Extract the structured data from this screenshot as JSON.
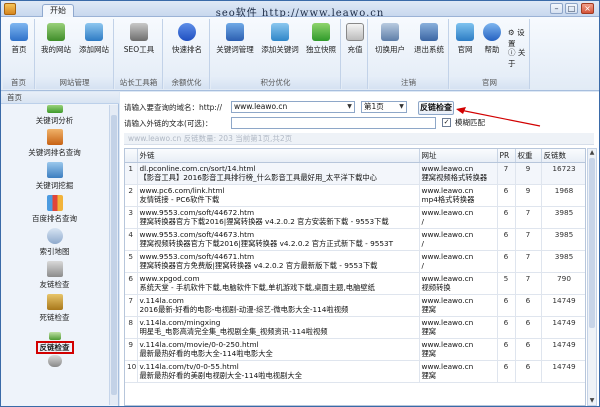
{
  "window": {
    "title": "seo软件   http://www.leawo.cn",
    "tab": "开始",
    "min": "–",
    "max": "□",
    "close": "×"
  },
  "ribbon": {
    "groups": [
      {
        "label": "首页",
        "buttons": [
          {
            "label": "首页",
            "icon": "home-icon"
          }
        ]
      },
      {
        "label": "网站管理",
        "buttons": [
          {
            "label": "我的网站",
            "icon": "my-site-icon"
          },
          {
            "label": "添加网站",
            "icon": "add-site-icon"
          }
        ]
      },
      {
        "label": "站长工具箱",
        "buttons": [
          {
            "label": "SEO工具",
            "icon": "tools-icon"
          }
        ]
      },
      {
        "label": "余额优化",
        "buttons": [
          {
            "label": "快速排名",
            "icon": "baidu-paw-icon"
          }
        ]
      },
      {
        "label": "积分优化",
        "buttons": [
          {
            "label": "关键词管理",
            "icon": "keyword-manage-icon"
          },
          {
            "label": "添加关键词",
            "icon": "add-keyword-icon"
          },
          {
            "label": "独立快照",
            "icon": "snapshot-icon"
          }
        ]
      },
      {
        "label": "",
        "buttons": [
          {
            "label": "充值",
            "icon": "recharge-icon"
          }
        ]
      },
      {
        "label": "注销",
        "buttons": [
          {
            "label": "切换用户",
            "icon": "switch-user-icon"
          },
          {
            "label": "退出系统",
            "icon": "exit-icon"
          }
        ]
      },
      {
        "label": "官网",
        "buttons": [
          {
            "label": "官网",
            "icon": "website-icon"
          },
          {
            "label": "帮助",
            "icon": "help-icon"
          }
        ]
      }
    ],
    "settings": "设置",
    "about": "关于"
  },
  "nav": {
    "header": "首页",
    "items": [
      {
        "label": "关键词分析",
        "icon": "keyword-analysis-icon"
      },
      {
        "label": "关键词排名查询",
        "icon": "rank-query-icon"
      },
      {
        "label": "关键词挖掘",
        "icon": "keyword-mining-icon"
      },
      {
        "label": "百度排名查询",
        "icon": "baidu-rank-icon"
      },
      {
        "label": "索引地图",
        "icon": "sitemap-icon"
      },
      {
        "label": "友链检查",
        "icon": "friend-link-icon"
      },
      {
        "label": "死链检查",
        "icon": "dead-link-icon"
      },
      {
        "label": "反链检查",
        "icon": "backlink-icon"
      }
    ]
  },
  "query": {
    "domain_label": "请输入要查询的域名：http://",
    "domain_value": "www.leawo.cn",
    "page_value": "第1页",
    "check_button": "反链检查",
    "text_label": "请输入外链的文本(可选)：",
    "text_value": "",
    "fuzzy_label": "模糊匹配",
    "fuzzy_checked": "✓",
    "status": "www.leawo.cn  反链数量: 203  当前第1页,共2页"
  },
  "table": {
    "columns": [
      "",
      "外链",
      "网址",
      "PR",
      "权重",
      "反链数"
    ],
    "rows": [
      {
        "n": "1",
        "url": "dl.pconline.com.cn/sort/14.html",
        "title": "【影音工具】2016影音工具排行榜_什么影音工具最好用_太平洋下载中心",
        "site": "www.leawo.cn",
        "site2": "狸窝视频格式转换器",
        "pr": "7",
        "w": "9",
        "bl": "16723"
      },
      {
        "n": "2",
        "url": "www.pc6.com/link.html",
        "title": "友情链接 - PC6软件下载",
        "site": "www.leawo.cn",
        "site2": "mp4格式转换器",
        "pr": "6",
        "w": "9",
        "bl": "1968"
      },
      {
        "n": "3",
        "url": "www.9553.com/soft/44672.htm",
        "title": "狸窝转换器官方下载2016|狸窝转换器 v4.2.0.2 官方安装新下载 - 9553下载",
        "site": "www.leawo.cn",
        "site2": "/",
        "pr": "6",
        "w": "7",
        "bl": "3985"
      },
      {
        "n": "4",
        "url": "www.9553.com/soft/44673.htm",
        "title": "狸窝视频转换器官方下载2016|狸窝转换器 v4.2.0.2 官方正式新下载 - 9553T",
        "site": "www.leawo.cn",
        "site2": "/",
        "pr": "6",
        "w": "7",
        "bl": "3985"
      },
      {
        "n": "5",
        "url": "www.9553.com/soft/44671.htm",
        "title": "狸窝转换器官方免费版|狸窝转换器 v4.2.0.2 官方最新版下载 - 9553下载",
        "site": "www.leawo.cn",
        "site2": "/",
        "pr": "6",
        "w": "7",
        "bl": "3985"
      },
      {
        "n": "6",
        "url": "www.xpgod.com",
        "title": "系统天堂 - 手机软件下载,电脑软件下载,单机游戏下载,桌面主题,电脑壁纸",
        "site": "www.leawo.cn",
        "site2": "视频转换",
        "pr": "5",
        "w": "7",
        "bl": "790"
      },
      {
        "n": "7",
        "url": "v.114la.com",
        "title": "2016最新-好看的电影-电视剧-动漫-综艺-微电影大全-114啦视频",
        "site": "www.leawo.cn",
        "site2": "狸窝",
        "pr": "6",
        "w": "6",
        "bl": "14749"
      },
      {
        "n": "8",
        "url": "v.114la.com/mingxing",
        "title": "明星毛_电影高清完全集_电视剧全集_视频资讯-114啦视频",
        "site": "www.leawo.cn",
        "site2": "狸窝",
        "pr": "6",
        "w": "6",
        "bl": "14749"
      },
      {
        "n": "9",
        "url": "v.114la.com/movie/0-0-250.html",
        "title": "最新最热好看的电影大全-114啦电影大全",
        "site": "www.leawo.cn",
        "site2": "狸窝",
        "pr": "6",
        "w": "6",
        "bl": "14749"
      },
      {
        "n": "10",
        "url": "v.114la.com/tv/0-0-55.html",
        "title": "最新最热好看的美剧电视剧大全-114啦电视剧大全",
        "site": "www.leawo.cn",
        "site2": "狸窝",
        "pr": "6",
        "w": "6",
        "bl": "14749"
      }
    ]
  },
  "colors": {
    "accent_red": "#d20000",
    "ribbon_bg": "#e2ebf6",
    "border": "#a7bedd"
  }
}
